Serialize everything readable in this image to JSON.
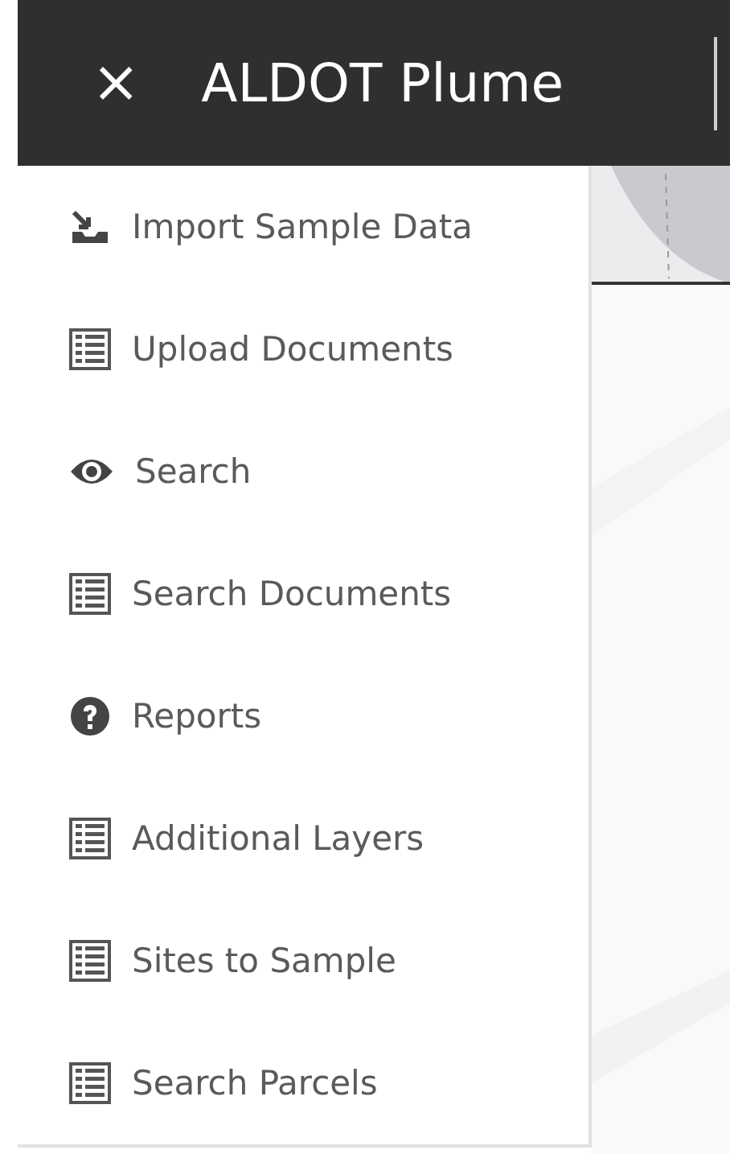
{
  "header": {
    "close": "×",
    "title": "ALDOT Plume"
  },
  "menu": {
    "items": [
      {
        "label": "Import Sample Data",
        "kind": "import"
      },
      {
        "label": "Upload Documents",
        "kind": "list"
      },
      {
        "label": "Search",
        "kind": "eye"
      },
      {
        "label": "Search Documents",
        "kind": "list"
      },
      {
        "label": "Reports",
        "kind": "help"
      },
      {
        "label": "Additional Layers",
        "kind": "list"
      },
      {
        "label": "Sites to Sample",
        "kind": "list"
      },
      {
        "label": "Search Parcels",
        "kind": "list"
      }
    ]
  }
}
